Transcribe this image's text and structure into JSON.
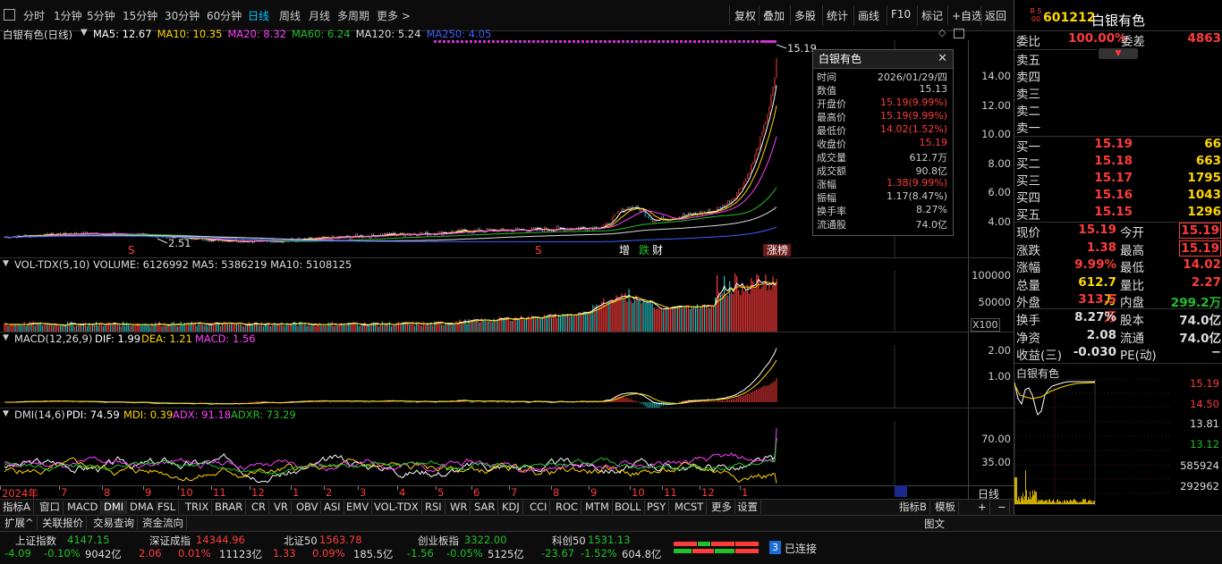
{
  "toolbar": {
    "periods": [
      "分时",
      "1分钟",
      "5分钟",
      "15分钟",
      "30分钟",
      "60分钟",
      "日线",
      "周线",
      "月线",
      "多周期",
      "更多 >"
    ],
    "active_period": "日线",
    "right_buttons": [
      "复权",
      "叠加",
      "多股",
      "统计",
      "画线",
      "F10",
      "标记",
      "+自选",
      "返回"
    ]
  },
  "main_chart": {
    "title": "白银有色(日线)",
    "ma": [
      {
        "label": "MA5: 12.67",
        "color": "#ffffff"
      },
      {
        "label": "MA10: 10.35",
        "color": "#ffd700"
      },
      {
        "label": "MA20: 8.32",
        "color": "#ff40ff"
      },
      {
        "label": "MA60: 6.24",
        "color": "#22c02a"
      },
      {
        "label": "MA120: 5.24",
        "color": "#dddddd"
      },
      {
        "label": "MA250: 4.05",
        "color": "#4060ff"
      }
    ],
    "y_ticks": [
      "14.00",
      "12.00",
      "10.00",
      "8.00",
      "6.00",
      "4.00"
    ],
    "high_label": "15.19",
    "low_label": "2.51",
    "markers": [
      {
        "text": "S",
        "color": "#ff3c3c"
      },
      {
        "text": "S",
        "color": "#ff3c3c"
      },
      {
        "text": "增",
        "color": "#ffffff"
      },
      {
        "text": "跌",
        "color": "#22c02a"
      },
      {
        "text": "财",
        "color": "#ffffff"
      },
      {
        "text": "涨榜",
        "color": "#ffffff"
      }
    ]
  },
  "tooltip": {
    "title": "白银有色",
    "rows": [
      {
        "k": "时间",
        "v": "2026/01/29/四",
        "c": "#cccccc"
      },
      {
        "k": "数值",
        "v": "15.13",
        "c": "#cccccc"
      },
      {
        "k": "开盘价",
        "v": "15.19(9.99%)",
        "c": "#ff3c3c"
      },
      {
        "k": "最高价",
        "v": "15.19(9.99%)",
        "c": "#ff3c3c"
      },
      {
        "k": "最低价",
        "v": "14.02(1.52%)",
        "c": "#ff3c3c"
      },
      {
        "k": "收盘价",
        "v": "15.19",
        "c": "#ff3c3c"
      },
      {
        "k": "成交量",
        "v": "612.7万",
        "c": "#cccccc"
      },
      {
        "k": "成交额",
        "v": "90.8亿",
        "c": "#cccccc"
      },
      {
        "k": "涨幅",
        "v": "1.38(9.99%)",
        "c": "#ff3c3c"
      },
      {
        "k": "振幅",
        "v": "1.17(8.47%)",
        "c": "#cccccc"
      },
      {
        "k": "换手率",
        "v": "8.27%",
        "c": "#cccccc"
      },
      {
        "k": "流通股",
        "v": "74.0亿",
        "c": "#cccccc"
      }
    ]
  },
  "volume_panel": {
    "title": "VOL-TDX(5,10)",
    "values": "VOLUME: 6126992  MA5: 5386219  MA10: 5108125",
    "y_ticks": [
      "100000",
      "50000"
    ],
    "unit": "X100"
  },
  "macd_panel": {
    "title": "MACD(12,26,9)",
    "dif": "DIF: 1.99",
    "dea": "DEA: 1.21",
    "macd": "MACD: 1.56",
    "y_ticks": [
      "2.00",
      "1.00"
    ]
  },
  "dmi_panel": {
    "title": "DMI(14,6)",
    "pdi": "PDI: 74.59",
    "mdi": "MDI: 0.39",
    "adx": "ADX: 91.18",
    "adxr": "ADXR: 73.29",
    "y_ticks": [
      "70.00",
      "35.00"
    ]
  },
  "x_axis": {
    "labels": [
      "2024年",
      "7",
      "8",
      "9",
      "10",
      "11",
      "12",
      "1",
      "2",
      "3",
      "4",
      "5",
      "6",
      "7",
      "8",
      "9",
      "10",
      "11",
      "12",
      "1"
    ],
    "period_label": "日线"
  },
  "indicator_tabs": [
    "指标A",
    "窗口",
    "MACD",
    "DMI",
    "DMA",
    "FSL",
    "TRIX",
    "BRAR",
    "CR",
    "VR",
    "OBV",
    "ASI",
    "EMV",
    "VOL-TDX",
    "RSI",
    "WR",
    "SAR",
    "KDJ",
    "CCI",
    "ROC",
    "MTM",
    "BOLL",
    "PSY",
    "MCST",
    "更多",
    "设置"
  ],
  "active_tab": "DMI",
  "right_tabs": [
    "指标B",
    "模板",
    "+",
    "−"
  ],
  "bottom_tabs": [
    "扩展^",
    "关联报价",
    "交易查询",
    "资金流向"
  ],
  "bottom_right_label": "图文",
  "quote": {
    "code": "601212",
    "name": "白银有色",
    "badge": "R 500",
    "weibi_label": "委比",
    "weibi": "100.00%",
    "weicha_label": "委差",
    "weicha": "4863",
    "sell": [
      {
        "label": "卖五",
        "price": "",
        "vol": ""
      },
      {
        "label": "卖四",
        "price": "",
        "vol": ""
      },
      {
        "label": "卖三",
        "price": "",
        "vol": ""
      },
      {
        "label": "卖二",
        "price": "",
        "vol": ""
      },
      {
        "label": "卖一",
        "price": "",
        "vol": ""
      }
    ],
    "buy": [
      {
        "label": "买一",
        "price": "15.19",
        "vol": "66"
      },
      {
        "label": "买二",
        "price": "15.18",
        "vol": "663"
      },
      {
        "label": "买三",
        "price": "15.17",
        "vol": "1795"
      },
      {
        "label": "买四",
        "price": "15.16",
        "vol": "1043"
      },
      {
        "label": "买五",
        "price": "15.15",
        "vol": "1296"
      }
    ],
    "stats": [
      {
        "l1": "现价",
        "v1": "15.19",
        "c1": "#ff3c3c",
        "l2": "今开",
        "v2": "15.19",
        "c2": "#ff3c3c",
        "box": true
      },
      {
        "l1": "涨跌",
        "v1": "1.38",
        "c1": "#ff3c3c",
        "l2": "最高",
        "v2": "15.19",
        "c2": "#ff3c3c",
        "box": true
      },
      {
        "l1": "涨幅",
        "v1": "9.99%",
        "c1": "#ff3c3c",
        "l2": "最低",
        "v2": "14.02",
        "c2": "#ff3c3c",
        "box": false
      },
      {
        "l1": "总量",
        "v1": "612.7万",
        "c1": "#ffd700",
        "l2": "量比",
        "v2": "2.27",
        "c2": "#ff3c3c",
        "box": false
      },
      {
        "l1": "外盘",
        "v1": "313.5万",
        "c1": "#ff3c3c",
        "l2": "内盘",
        "v2": "299.2万",
        "c2": "#22c02a",
        "box": false
      },
      {
        "l1": "换手",
        "v1": "8.27%",
        "c1": "#dddddd",
        "l2": "股本",
        "v2": "74.0亿",
        "c2": "#dddddd",
        "box": false
      },
      {
        "l1": "净资",
        "v1": "2.08",
        "c1": "#dddddd",
        "l2": "流通",
        "v2": "74.0亿",
        "c2": "#dddddd",
        "box": false
      },
      {
        "l1": "收益(三)",
        "v1": "-0.030",
        "c1": "#dddddd",
        "l2": "PE(动)",
        "v2": "−",
        "c2": "#dddddd",
        "box": false
      }
    ],
    "mini_title": "白银有色",
    "mini_ticks": [
      {
        "v": "15.19",
        "c": "#ff3c3c"
      },
      {
        "v": "14.50",
        "c": "#ff3c3c"
      },
      {
        "v": "13.81",
        "c": "#dddddd"
      },
      {
        "v": "13.12",
        "c": "#22c02a"
      },
      {
        "v": "585924",
        "c": "#dddddd"
      },
      {
        "v": "292962",
        "c": "#dddddd"
      }
    ]
  },
  "status": {
    "indices": [
      {
        "name": "上证指数",
        "value": "4147.15",
        "chg": "-4.09",
        "pct": "-0.10%",
        "amt": "9042亿",
        "color": "#22c02a"
      },
      {
        "name": "深证成指",
        "value": "14344.96",
        "chg": "2.06",
        "pct": "0.01%",
        "amt": "11123亿",
        "color": "#ff3c3c"
      },
      {
        "name": "北证50",
        "value": "1563.78",
        "chg": "1.33",
        "pct": "0.09%",
        "amt": "185.5亿",
        "color": "#ff3c3c"
      },
      {
        "name": "创业板指",
        "value": "3322.00",
        "chg": "-1.56",
        "pct": "-0.05%",
        "amt": "5125亿",
        "color": "#22c02a"
      },
      {
        "name": "科创50",
        "value": "1531.13",
        "chg": "-23.67",
        "pct": "-1.52%",
        "amt": "604.8亿",
        "color": "#22c02a"
      }
    ],
    "conn_count": "3",
    "conn_text": "已连接"
  }
}
